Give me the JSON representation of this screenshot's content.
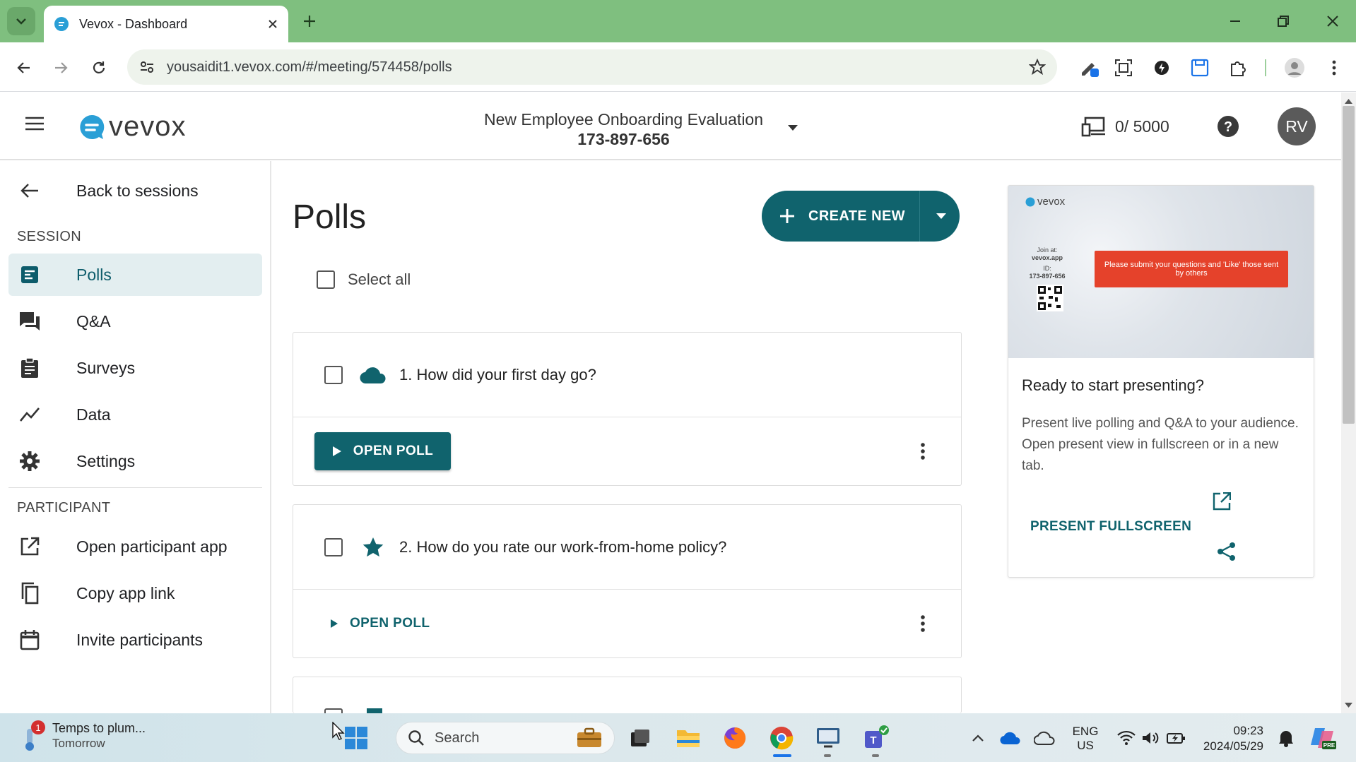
{
  "browser": {
    "tab_title": "Vevox - Dashboard",
    "url": "yousaidit1.vevox.com/#/meeting/574458/polls"
  },
  "header": {
    "logo_text": "vevox",
    "meeting_title": "New Employee Onboarding Evaluation",
    "meeting_id": "173-897-656",
    "usage": "0/ 5000",
    "avatar_initials": "RV"
  },
  "sidebar": {
    "back_label": "Back to sessions",
    "session_section": "SESSION",
    "session_items": [
      {
        "label": "Polls",
        "icon": "polls-icon"
      },
      {
        "label": "Q&A",
        "icon": "qa-icon"
      },
      {
        "label": "Surveys",
        "icon": "surveys-icon"
      },
      {
        "label": "Data",
        "icon": "data-chart-icon"
      },
      {
        "label": "Settings",
        "icon": "gear-icon"
      }
    ],
    "participant_section": "PARTICIPANT",
    "participant_items": [
      {
        "label": "Open participant app",
        "icon": "open-external-icon"
      },
      {
        "label": "Copy app link",
        "icon": "copy-icon"
      },
      {
        "label": "Invite participants",
        "icon": "calendar-icon"
      }
    ]
  },
  "main": {
    "title": "Polls",
    "create_label": "CREATE NEW",
    "select_all_label": "Select all",
    "polls": [
      {
        "question": "1. How did your first day go?",
        "icon": "word-cloud-icon",
        "action": "OPEN POLL"
      },
      {
        "question": "2. How do you rate our work-from-home policy?",
        "icon": "star-icon",
        "action": "OPEN POLL"
      }
    ]
  },
  "present_panel": {
    "preview_logo": "vevox",
    "preview_join": "Join at:",
    "preview_site": "vevox.app",
    "preview_id_label": "ID:",
    "preview_id": "173-897-656",
    "preview_message": "Please submit your questions and 'Like' those sent by others",
    "title": "Ready to start presenting?",
    "description": "Present live polling and Q&A to your audience. Open present view in fullscreen or in a new tab.",
    "present_label": "PRESENT FULLSCREEN"
  },
  "taskbar": {
    "weather_title": "Temps to plum...",
    "weather_sub": "Tomorrow",
    "weather_badge": "1",
    "search_placeholder": "Search",
    "lang_top": "ENG",
    "lang_bottom": "US",
    "time": "09:23",
    "date": "2024/05/29"
  },
  "colors": {
    "accent": "#10636d",
    "browser_frame": "#7fbf7f",
    "active_nav_bg": "#e3eef0"
  }
}
